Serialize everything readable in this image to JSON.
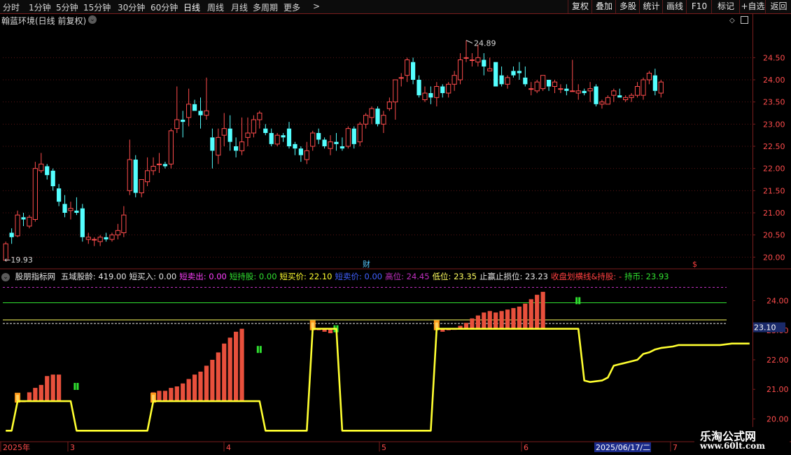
{
  "toolbar": {
    "periods": [
      "分时",
      "1分钟",
      "5分钟",
      "15分钟",
      "30分钟",
      "60分钟",
      "日线",
      "周线",
      "月线",
      "多周期",
      "更多"
    ],
    "active_period": "日线",
    "right_buttons": [
      "复权",
      "叠加",
      "多股",
      "统计",
      "画线",
      "F10",
      "标记",
      "+自选",
      "返回"
    ]
  },
  "main_panel": {
    "title": "翰蓝环境(日线 前复权)",
    "high_label": "24.89",
    "low_label": "19.93",
    "fin_marker": "财",
    "dollar_marker": "$"
  },
  "indicator": {
    "name": "股朋指标网",
    "fields": [
      {
        "label": "五域股龄: 419.00",
        "color": "#e6e6e6"
      },
      {
        "label": "短买入: 0.00",
        "color": "#e6e6e6"
      },
      {
        "label": "短卖出: 0.00",
        "color": "#ff40ff"
      },
      {
        "label": "短持股: 0.00",
        "color": "#30e030"
      },
      {
        "label": "短买价: 22.10",
        "color": "#ffff30"
      },
      {
        "label": "短卖价: 0.00",
        "color": "#4060ff"
      },
      {
        "label": "高位: 24.45",
        "color": "#c030c0"
      },
      {
        "label": "低位: 23.35",
        "color": "#ffff60"
      },
      {
        "label": "止赢止损位: 23.23",
        "color": "#e6e6e6"
      },
      {
        "label": "收盘划横线&持股: -",
        "color": "#ff4040"
      },
      {
        "label": "持币: 23.93",
        "color": "#30e030"
      }
    ],
    "current_value_label": "23.10"
  },
  "date_axis": {
    "labels": [
      "2025年",
      "3",
      "4",
      "5",
      "6",
      "7"
    ],
    "cursor_date": "2025/06/17/二"
  },
  "watermark": {
    "line1": "乐淘公式网",
    "line2": "www.60lt.com"
  },
  "colors": {
    "up": "#ff4c4c",
    "down": "#54ffff",
    "border": "#7a1d1d",
    "yellow": "#ffff30"
  },
  "chart_data": [
    {
      "type": "candlestick",
      "title": "翰蓝环境(日线 前复权)",
      "y_ticks": [
        20.0,
        20.5,
        21.0,
        21.5,
        22.0,
        22.5,
        23.0,
        23.5,
        24.0,
        24.5
      ],
      "ylim": [
        19.8,
        25.2
      ],
      "ohlc": [
        [
          19.93,
          20.35,
          19.93,
          20.3
        ],
        [
          20.55,
          20.65,
          20.3,
          20.45
        ],
        [
          20.48,
          21.05,
          20.45,
          20.95
        ],
        [
          20.9,
          21.0,
          20.7,
          20.85
        ],
        [
          20.7,
          20.95,
          20.65,
          20.9
        ],
        [
          20.85,
          22.15,
          20.8,
          22.0
        ],
        [
          21.95,
          22.35,
          21.9,
          22.1
        ],
        [
          22.05,
          22.1,
          21.75,
          21.85
        ],
        [
          21.95,
          22.0,
          21.5,
          21.6
        ],
        [
          21.55,
          21.65,
          21.15,
          21.25
        ],
        [
          21.2,
          21.4,
          20.9,
          21.0
        ],
        [
          21.05,
          21.25,
          20.85,
          21.1
        ],
        [
          21.05,
          21.35,
          20.95,
          21.0
        ],
        [
          21.1,
          21.2,
          20.35,
          20.45
        ],
        [
          20.4,
          20.55,
          20.3,
          20.45
        ],
        [
          20.4,
          20.45,
          20.25,
          20.4
        ],
        [
          20.35,
          20.5,
          20.25,
          20.45
        ],
        [
          20.45,
          20.55,
          20.35,
          20.4
        ],
        [
          20.4,
          20.55,
          20.35,
          20.5
        ],
        [
          20.5,
          20.75,
          20.4,
          20.6
        ],
        [
          20.55,
          21.15,
          20.45,
          20.95
        ],
        [
          21.5,
          22.65,
          21.4,
          22.2
        ],
        [
          22.2,
          22.3,
          21.35,
          21.45
        ],
        [
          21.45,
          21.75,
          21.35,
          21.75
        ],
        [
          21.7,
          22.25,
          21.6,
          21.95
        ],
        [
          21.95,
          22.25,
          21.85,
          22.05
        ],
        [
          22.1,
          22.35,
          21.9,
          22.1
        ],
        [
          22.1,
          22.15,
          22.0,
          22.05
        ],
        [
          22.1,
          22.9,
          22.0,
          22.85
        ],
        [
          22.9,
          23.85,
          22.8,
          23.1
        ],
        [
          23.1,
          23.3,
          22.7,
          23.05
        ],
        [
          23.15,
          23.8,
          22.95,
          23.45
        ],
        [
          23.45,
          23.55,
          23.3,
          23.3
        ],
        [
          23.3,
          23.6,
          22.9,
          23.2
        ],
        [
          23.2,
          24.05,
          23.1,
          23.3
        ],
        [
          22.7,
          22.9,
          22.0,
          22.4
        ],
        [
          22.3,
          22.9,
          22.1,
          22.7
        ],
        [
          22.75,
          23.25,
          22.5,
          22.9
        ],
        [
          22.9,
          23.2,
          22.4,
          22.6
        ],
        [
          22.5,
          22.7,
          22.25,
          22.4
        ],
        [
          22.4,
          23.15,
          22.3,
          22.6
        ],
        [
          22.7,
          23.15,
          22.5,
          22.8
        ],
        [
          22.8,
          23.2,
          22.7,
          23.1
        ],
        [
          23.1,
          23.3,
          22.9,
          23.25
        ],
        [
          22.9,
          23.0,
          22.75,
          22.8
        ],
        [
          22.8,
          22.9,
          22.5,
          22.55
        ],
        [
          22.55,
          22.8,
          22.5,
          22.75
        ],
        [
          22.75,
          22.8,
          22.6,
          22.7
        ],
        [
          22.9,
          23.05,
          22.45,
          22.5
        ],
        [
          22.55,
          22.6,
          22.3,
          22.45
        ],
        [
          22.45,
          22.5,
          22.15,
          22.3
        ],
        [
          22.2,
          22.6,
          22.1,
          22.4
        ],
        [
          22.5,
          22.85,
          22.4,
          22.8
        ],
        [
          22.8,
          22.9,
          22.55,
          22.65
        ],
        [
          22.65,
          22.7,
          22.45,
          22.5
        ],
        [
          22.45,
          22.75,
          22.3,
          22.6
        ],
        [
          22.6,
          22.8,
          22.4,
          22.55
        ],
        [
          22.5,
          22.7,
          22.4,
          22.45
        ],
        [
          22.5,
          22.95,
          22.45,
          22.9
        ],
        [
          22.9,
          22.95,
          22.45,
          22.55
        ],
        [
          22.6,
          23.05,
          22.5,
          23.0
        ],
        [
          23.0,
          23.25,
          22.9,
          23.2
        ],
        [
          23.15,
          23.4,
          23.0,
          23.35
        ],
        [
          23.35,
          23.4,
          22.95,
          23.0
        ],
        [
          23.0,
          23.3,
          22.8,
          23.2
        ],
        [
          23.35,
          23.6,
          23.3,
          23.5
        ],
        [
          23.5,
          24.0,
          23.1,
          24.0
        ],
        [
          24.05,
          24.15,
          23.85,
          24.05
        ],
        [
          24.1,
          24.5,
          23.95,
          24.45
        ],
        [
          24.4,
          24.5,
          23.9,
          24.0
        ],
        [
          24.0,
          24.1,
          23.6,
          23.65
        ],
        [
          23.55,
          23.85,
          23.5,
          23.7
        ],
        [
          23.7,
          23.85,
          23.45,
          23.6
        ],
        [
          23.6,
          23.95,
          23.4,
          23.85
        ],
        [
          23.85,
          23.9,
          23.6,
          23.7
        ],
        [
          23.7,
          23.95,
          23.6,
          23.9
        ],
        [
          23.9,
          24.2,
          23.75,
          24.1
        ],
        [
          24.0,
          24.6,
          23.9,
          24.45
        ],
        [
          24.5,
          24.89,
          24.4,
          24.5
        ],
        [
          24.45,
          24.6,
          24.3,
          24.45
        ],
        [
          24.4,
          24.8,
          24.3,
          24.5
        ],
        [
          24.45,
          24.6,
          24.1,
          24.3
        ],
        [
          24.2,
          24.5,
          24.2,
          24.25
        ],
        [
          24.4,
          24.4,
          23.85,
          23.85
        ],
        [
          24.1,
          24.3,
          23.85,
          23.9
        ],
        [
          23.9,
          24.1,
          23.8,
          24.05
        ],
        [
          24.2,
          24.3,
          24.05,
          24.1
        ],
        [
          24.2,
          24.4,
          24.0,
          24.15
        ],
        [
          24.05,
          24.3,
          23.85,
          23.9
        ],
        [
          23.8,
          23.95,
          23.65,
          23.8
        ],
        [
          23.75,
          24.0,
          23.7,
          23.95
        ],
        [
          23.8,
          24.1,
          23.75,
          24.1
        ],
        [
          24.0,
          24.0,
          23.75,
          23.85
        ],
        [
          23.85,
          24.0,
          23.7,
          23.95
        ],
        [
          23.8,
          23.9,
          23.7,
          23.8
        ],
        [
          23.8,
          23.9,
          23.65,
          23.75
        ],
        [
          23.75,
          24.45,
          23.75,
          23.75
        ],
        [
          23.7,
          23.9,
          23.55,
          23.75
        ],
        [
          23.75,
          23.8,
          23.65,
          23.7
        ],
        [
          23.75,
          23.95,
          23.5,
          23.8
        ],
        [
          23.85,
          23.9,
          23.4,
          23.45
        ],
        [
          23.45,
          23.55,
          23.35,
          23.5
        ],
        [
          23.45,
          23.65,
          23.45,
          23.6
        ],
        [
          23.65,
          23.8,
          23.5,
          23.75
        ],
        [
          23.65,
          23.8,
          23.6,
          23.6
        ],
        [
          23.55,
          23.65,
          23.5,
          23.6
        ],
        [
          23.6,
          23.7,
          23.5,
          23.65
        ],
        [
          23.65,
          23.95,
          23.6,
          23.85
        ],
        [
          23.65,
          24.05,
          23.55,
          24.0
        ],
        [
          24.0,
          24.2,
          23.9,
          24.15
        ],
        [
          24.1,
          24.25,
          23.65,
          23.75
        ],
        [
          23.7,
          24.0,
          23.6,
          23.95
        ]
      ]
    },
    {
      "type": "bar+line",
      "title": "股朋指标网",
      "y_ticks": [
        20.0,
        21.0,
        22.0,
        23.0,
        24.0
      ],
      "ylim": [
        19.3,
        24.7
      ],
      "horizontal_lines": [
        {
          "name": "高位",
          "value": 24.45,
          "color": "#c030c0"
        },
        {
          "name": "持币",
          "value": 23.93,
          "color": "#30e030"
        },
        {
          "name": "低位",
          "value": 23.35,
          "color": "#ffff60"
        },
        {
          "name": "止赢止损位",
          "value": 23.23,
          "color": "#e6e6e6"
        }
      ],
      "segments": [
        {
          "start": 2,
          "base": 20.6,
          "tops": [
            20.8,
            20.6,
            20.9,
            21.05,
            21.15,
            21.45,
            21.5,
            21.5
          ]
        },
        {
          "start": 25,
          "base": 20.6,
          "tops": [
            20.9,
            20.95,
            20.95,
            21.05,
            21.1,
            21.2,
            21.35,
            21.5,
            21.6,
            21.8,
            22.0,
            22.25,
            22.55,
            22.75,
            22.95,
            23.05
          ]
        },
        {
          "start": 52,
          "base": 23.05,
          "tops": [
            23.25,
            23.0,
            22.95,
            22.9
          ]
        },
        {
          "start": 73,
          "base": 23.05,
          "tops": [
            23.2,
            22.95,
            23.0,
            23.05,
            23.15,
            23.25,
            23.4,
            23.5,
            23.6,
            23.65,
            23.6,
            23.65,
            23.7,
            23.75,
            23.8,
            23.9,
            24.05,
            24.2,
            24.3
          ]
        }
      ],
      "sell_markers": [
        {
          "bar": 12,
          "value": 21.1
        },
        {
          "bar": 43,
          "value": 22.35
        },
        {
          "bar": 56,
          "value": 23.05
        },
        {
          "bar": 97,
          "value": 24.0
        }
      ],
      "yellow_line": [
        [
          0,
          19.6
        ],
        [
          1,
          19.6
        ],
        [
          2,
          20.6
        ],
        [
          11,
          20.6
        ],
        [
          12,
          19.6
        ],
        [
          24,
          19.6
        ],
        [
          25,
          20.6
        ],
        [
          43,
          20.6
        ],
        [
          44,
          19.6
        ],
        [
          51,
          19.6
        ],
        [
          52,
          23.05
        ],
        [
          56,
          23.05
        ],
        [
          57,
          19.6
        ],
        [
          72,
          19.6
        ],
        [
          73,
          23.05
        ],
        [
          97,
          23.05
        ],
        [
          98,
          21.3
        ],
        [
          99,
          21.25
        ],
        [
          101,
          21.3
        ],
        [
          102,
          21.4
        ],
        [
          103,
          21.8
        ],
        [
          104,
          21.85
        ],
        [
          105,
          21.9
        ],
        [
          107,
          22.0
        ],
        [
          108,
          22.2
        ],
        [
          109,
          22.25
        ],
        [
          110,
          22.35
        ],
        [
          111,
          22.4
        ],
        [
          113,
          22.45
        ],
        [
          114,
          22.5
        ],
        [
          121,
          22.5
        ],
        [
          123,
          22.55
        ],
        [
          124,
          22.55
        ],
        [
          126,
          22.55
        ]
      ]
    }
  ]
}
